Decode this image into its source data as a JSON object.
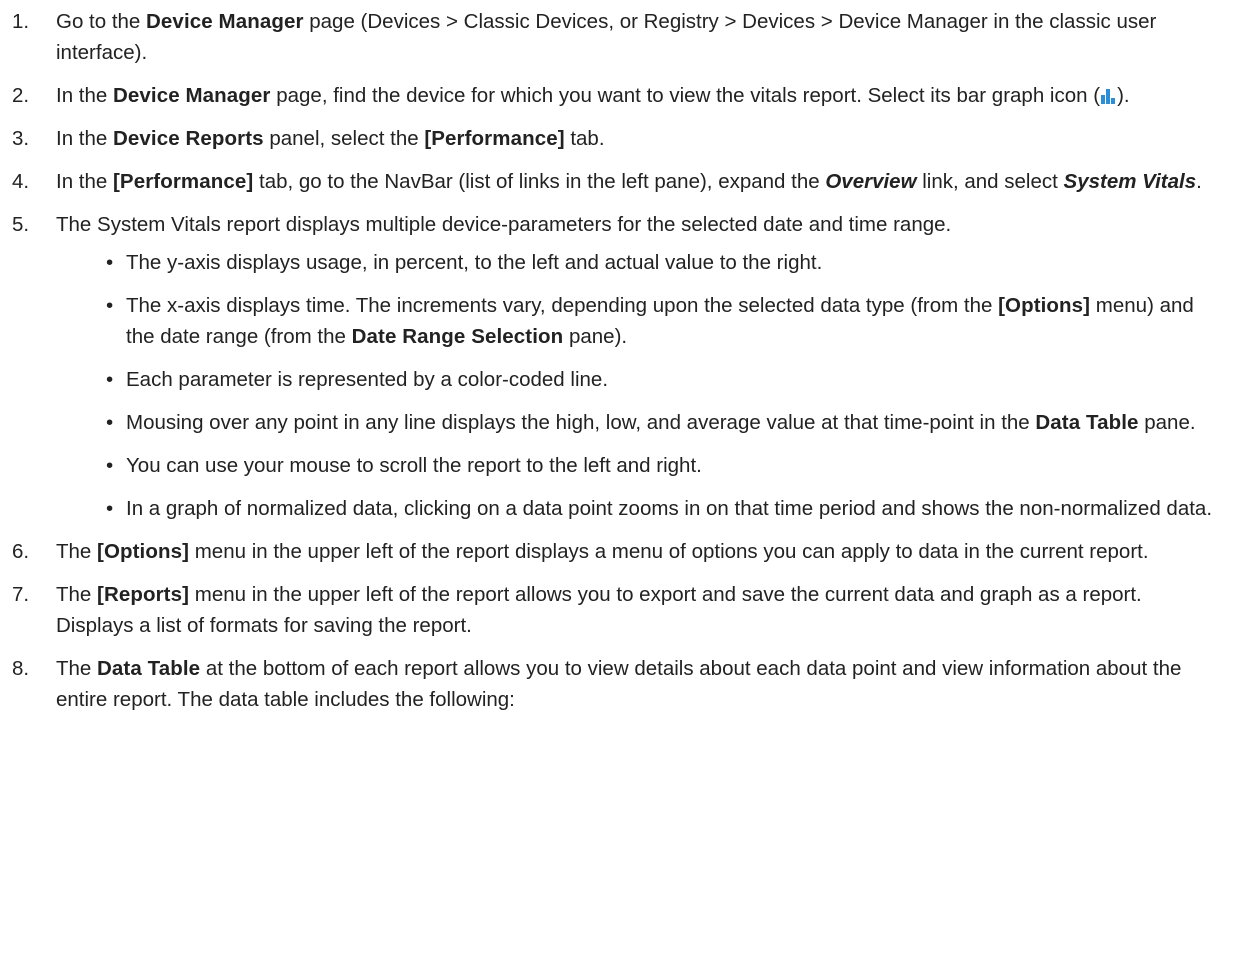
{
  "steps": [
    {
      "num": "1.",
      "parts": [
        {
          "t": "Go to the "
        },
        {
          "t": "Device Manager",
          "b": true
        },
        {
          "t": " page (Devices > Classic Devices, or Registry > Devices > Device Manager in the classic user interface)."
        }
      ]
    },
    {
      "num": "2.",
      "parts": [
        {
          "t": "In the "
        },
        {
          "t": "Device Manager",
          "b": true
        },
        {
          "t": " page, find the device for which you want to view the vitals report. Select its bar graph icon ("
        },
        {
          "icon": "bar-graph-icon"
        },
        {
          "t": ")."
        }
      ]
    },
    {
      "num": "3.",
      "parts": [
        {
          "t": "In the "
        },
        {
          "t": "Device Reports",
          "b": true
        },
        {
          "t": " panel, select the "
        },
        {
          "t": "[Performance]",
          "b": true
        },
        {
          "t": " tab."
        }
      ]
    },
    {
      "num": "4.",
      "parts": [
        {
          "t": "In the "
        },
        {
          "t": "[Performance]",
          "b": true
        },
        {
          "t": " tab, go to the NavBar (list of links in the left pane), expand the "
        },
        {
          "t": "Overview",
          "bi": true
        },
        {
          "t": " link, and select "
        },
        {
          "t": "System Vitals",
          "bi": true
        },
        {
          "t": "."
        }
      ]
    },
    {
      "num": "5.",
      "parts": [
        {
          "t": "The System Vitals report displays multiple device-parameters for the selected date and time range."
        }
      ],
      "bullets": [
        [
          {
            "t": "The y-axis displays usage, in percent, to the left and actual value to the right."
          }
        ],
        [
          {
            "t": "The x-axis displays time. The increments vary, depending upon the selected data type (from the "
          },
          {
            "t": "[Options]",
            "b": true
          },
          {
            "t": " menu) and the date range (from the "
          },
          {
            "t": "Date Range Selection",
            "b": true
          },
          {
            "t": " pane)."
          }
        ],
        [
          {
            "t": "Each parameter is represented by a color-coded line."
          }
        ],
        [
          {
            "t": "Mousing over any point in any line displays the high, low, and average value at that time-point in the "
          },
          {
            "t": "Data Table",
            "b": true
          },
          {
            "t": " pane."
          }
        ],
        [
          {
            "t": "You can use your mouse to scroll the report to the left and right."
          }
        ],
        [
          {
            "t": "In a graph of normalized data, clicking on a data point zooms in on that time period and shows the non-normalized data."
          }
        ]
      ]
    },
    {
      "num": "6.",
      "parts": [
        {
          "t": "The "
        },
        {
          "t": "[Options]",
          "b": true
        },
        {
          "t": " menu in the upper left of the report displays a menu of options you can apply to data in the current report."
        }
      ]
    },
    {
      "num": "7.",
      "parts": [
        {
          "t": "The "
        },
        {
          "t": "[Reports]",
          "b": true
        },
        {
          "t": " menu in the upper left of the report allows you to export and save the current data and graph as a report. Displays a list of formats for saving the report."
        }
      ]
    },
    {
      "num": "8.",
      "parts": [
        {
          "t": "The "
        },
        {
          "t": "Data Table",
          "b": true
        },
        {
          "t": " at the bottom of each report allows you to view details about each data point and view information about the entire report. The data table includes the following:"
        }
      ]
    }
  ],
  "bullet_glyph": "•",
  "colors": {
    "text": "#222222",
    "icon_bar": "#2a8fd8"
  }
}
